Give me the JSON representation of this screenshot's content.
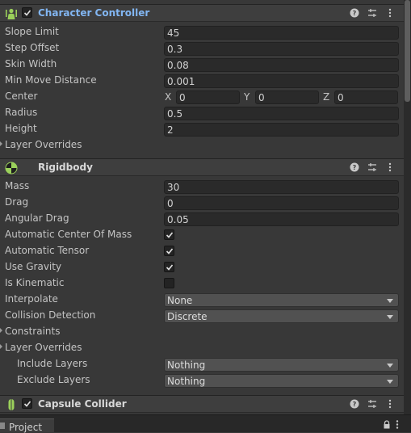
{
  "character_controller": {
    "title": "Character Controller",
    "enabled": true,
    "fields": {
      "slope_limit": {
        "label": "Slope Limit",
        "value": "45"
      },
      "step_offset": {
        "label": "Step Offset",
        "value": "0.3"
      },
      "skin_width": {
        "label": "Skin Width",
        "value": "0.08"
      },
      "min_move_distance": {
        "label": "Min Move Distance",
        "value": "0.001"
      },
      "center": {
        "label": "Center",
        "x_label": "X",
        "x": "0",
        "y_label": "Y",
        "y": "0",
        "z_label": "Z",
        "z": "0"
      },
      "radius": {
        "label": "Radius",
        "value": "0.5"
      },
      "height": {
        "label": "Height",
        "value": "2"
      },
      "layer_overrides": {
        "label": "Layer Overrides"
      }
    }
  },
  "rigidbody": {
    "title": "Rigidbody",
    "fields": {
      "mass": {
        "label": "Mass",
        "value": "30"
      },
      "drag": {
        "label": "Drag",
        "value": "0"
      },
      "angular_drag": {
        "label": "Angular Drag",
        "value": "0.05"
      },
      "automatic_center_of_mass": {
        "label": "Automatic Center Of Mass",
        "checked": true
      },
      "automatic_tensor": {
        "label": "Automatic Tensor",
        "checked": true
      },
      "use_gravity": {
        "label": "Use Gravity",
        "checked": true
      },
      "is_kinematic": {
        "label": "Is Kinematic",
        "checked": false
      },
      "interpolate": {
        "label": "Interpolate",
        "value": "None"
      },
      "collision_detection": {
        "label": "Collision Detection",
        "value": "Discrete"
      },
      "constraints": {
        "label": "Constraints"
      },
      "layer_overrides": {
        "label": "Layer Overrides"
      },
      "include_layers": {
        "label": "Include Layers",
        "value": "Nothing"
      },
      "exclude_layers": {
        "label": "Exclude Layers",
        "value": "Nothing"
      }
    }
  },
  "capsule_collider": {
    "title": "Capsule Collider",
    "enabled": true
  },
  "bottom_bar": {
    "tab_label": "Project"
  },
  "colors": {
    "accent_title": "#82b6f2",
    "background": "#383838",
    "header": "#3e3e3e",
    "field": "#2a2a2a"
  },
  "icons": {
    "header_help": "help-icon",
    "header_presets": "presets-icon",
    "header_menu": "kebab-menu-icon",
    "character_controller": "character-controller-icon",
    "rigidbody": "rigidbody-icon",
    "capsule_collider": "capsule-collider-icon"
  }
}
